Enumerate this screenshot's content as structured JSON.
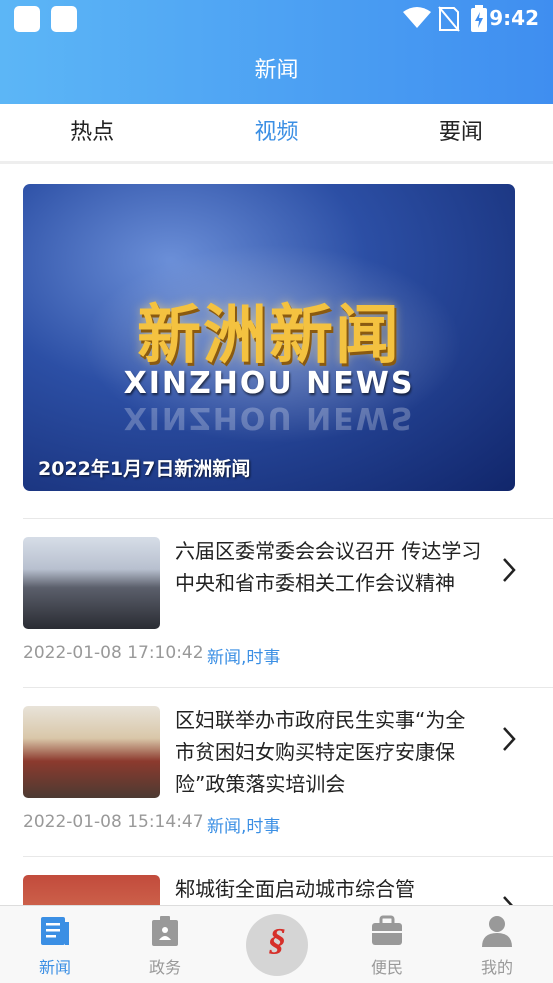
{
  "status_bar": {
    "time": "9:42"
  },
  "header": {
    "title": "新闻"
  },
  "tabs": [
    {
      "label": "热点",
      "active": false
    },
    {
      "label": "视频",
      "active": true
    },
    {
      "label": "要闻",
      "active": false
    }
  ],
  "feature": {
    "title_cn": "新洲新闻",
    "title_en": "XINZHOU NEWS",
    "caption": "2022年1月7日新洲新闻"
  },
  "news": [
    {
      "title": "六届区委常委会会议召开 传达学习中央和省市委相关工作会议精神",
      "date": "2022-01-08 17:10:42",
      "category": "新闻,时事"
    },
    {
      "title": "区妇联举办市政府民生实事“为全市贫困妇女购买特定医疗安康保险”政策落实培训会",
      "date": "2022-01-08 15:14:47",
      "category": "新闻,时事"
    },
    {
      "title": "邾城街全面启动城市综合管",
      "date": "",
      "category": ""
    }
  ],
  "bottom_nav": [
    {
      "label": "新闻",
      "icon": "news-icon",
      "active": true
    },
    {
      "label": "政务",
      "icon": "government-icon",
      "active": false
    },
    {
      "label": "便民",
      "icon": "briefcase-icon",
      "active": false
    },
    {
      "label": "我的",
      "icon": "person-icon",
      "active": false
    }
  ],
  "colors": {
    "accent": "#3b8fe4",
    "header_start": "#5cb6f6",
    "header_end": "#3f8ef0"
  }
}
